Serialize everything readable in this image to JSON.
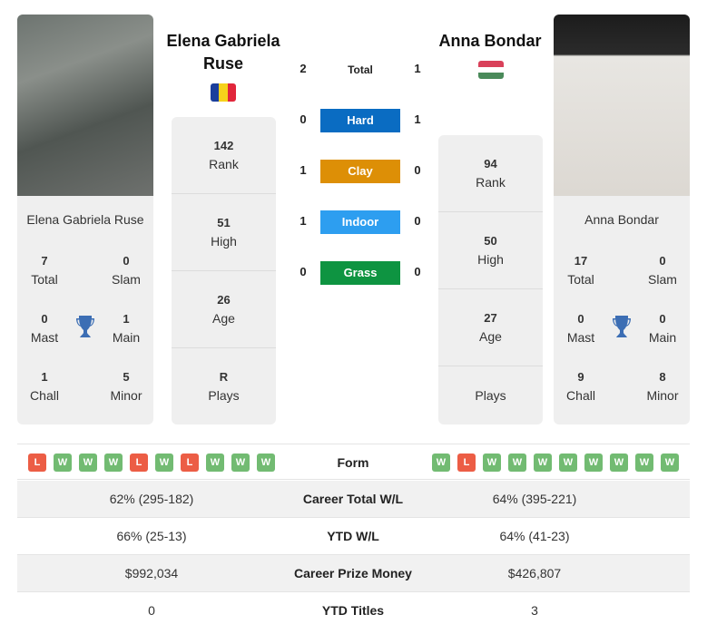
{
  "player1": {
    "name": "Elena Gabriela Ruse",
    "name_line1": "Elena Gabriela",
    "name_line2": "Ruse",
    "flag": "romania-flag",
    "titles": {
      "total": "7",
      "slam": "0",
      "mast": "0",
      "main": "1",
      "chall": "1",
      "minor": "5"
    },
    "rank": "142",
    "high": "51",
    "age": "26",
    "plays": "R",
    "form": [
      "L",
      "W",
      "W",
      "W",
      "L",
      "W",
      "L",
      "W",
      "W",
      "W"
    ],
    "career_wl": "62% (295-182)",
    "ytd_wl": "66% (25-13)",
    "prize": "$992,034",
    "ytd_titles": "0"
  },
  "player2": {
    "name": "Anna Bondar",
    "flag": "hungary-flag",
    "titles": {
      "total": "17",
      "slam": "0",
      "mast": "0",
      "main": "0",
      "chall": "9",
      "minor": "8"
    },
    "rank": "94",
    "high": "50",
    "age": "27",
    "plays": "",
    "form": [
      "W",
      "L",
      "W",
      "W",
      "W",
      "W",
      "W",
      "W",
      "W",
      "W"
    ],
    "career_wl": "64% (395-221)",
    "ytd_wl": "64% (41-23)",
    "prize": "$426,807",
    "ytd_titles": "3"
  },
  "labels": {
    "total": "Total",
    "slam": "Slam",
    "mast": "Mast",
    "main": "Main",
    "chall": "Chall",
    "minor": "Minor",
    "rank": "Rank",
    "high": "High",
    "age": "Age",
    "plays": "Plays",
    "form": "Form",
    "career_wl": "Career Total W/L",
    "ytd_wl": "YTD W/L",
    "prize": "Career Prize Money",
    "ytd_titles": "YTD Titles"
  },
  "h2h": {
    "total": {
      "label": "Total",
      "p1": "2",
      "p2": "1"
    },
    "surfaces": [
      {
        "label": "Hard",
        "p1": "0",
        "p2": "1",
        "color": "#0a6cc2"
      },
      {
        "label": "Clay",
        "p1": "1",
        "p2": "0",
        "color": "#dd8f06"
      },
      {
        "label": "Indoor",
        "p1": "1",
        "p2": "0",
        "color": "#2d9ef0"
      },
      {
        "label": "Grass",
        "p1": "0",
        "p2": "0",
        "color": "#0e9441"
      }
    ]
  },
  "colors": {
    "win": "#72bb72",
    "loss": "#ec5d45",
    "trophy": "#3c6eb4"
  }
}
